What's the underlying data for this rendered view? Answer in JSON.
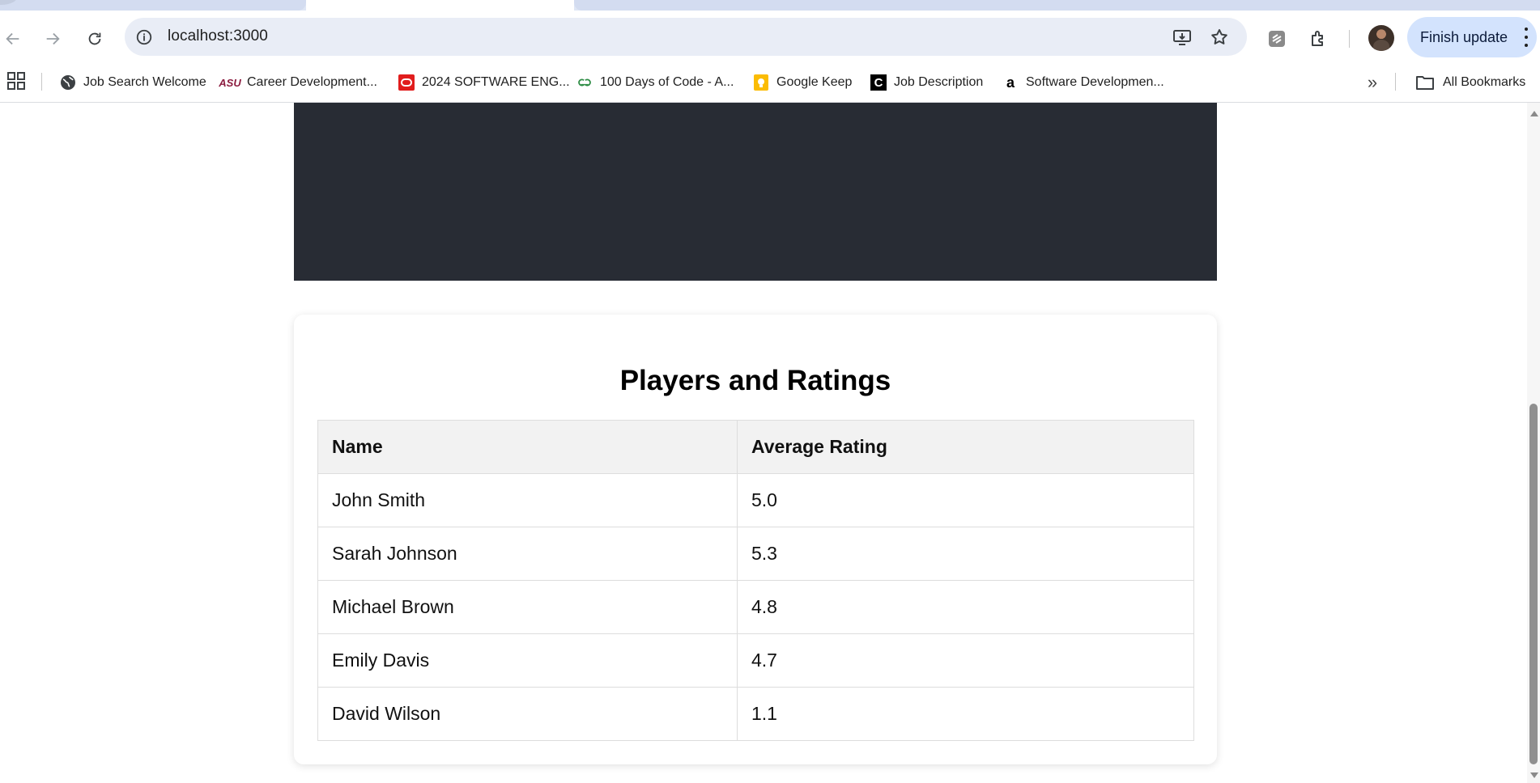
{
  "browser": {
    "url": "localhost:3000",
    "update_label": "Finish update",
    "bookmarks": [
      {
        "label": "Job Search Welcome",
        "icon": "globe-icon"
      },
      {
        "label": "Career Development...",
        "icon": "asu-logo-icon"
      },
      {
        "label": "2024 SOFTWARE ENG...",
        "icon": "oracle-logo-icon"
      },
      {
        "label": "100 Days of Code - A...",
        "icon": "geeksforgeeks-logo-icon"
      },
      {
        "label": "Google Keep",
        "icon": "google-keep-icon"
      },
      {
        "label": "Job Description",
        "icon": "c-logo-icon"
      },
      {
        "label": "Software Developmen...",
        "icon": "amazon-logo-icon"
      }
    ],
    "all_bookmarks_label": "All Bookmarks",
    "bookmark_more": "»",
    "asu_mark": "ASU",
    "c_mark": "C",
    "amazon_mark": "a"
  },
  "page": {
    "title": "Players and Ratings",
    "table": {
      "headers": [
        "Name",
        "Average Rating"
      ],
      "rows": [
        [
          "John Smith",
          "5.0"
        ],
        [
          "Sarah Johnson",
          "5.3"
        ],
        [
          "Michael Brown",
          "4.8"
        ],
        [
          "Emily Davis",
          "4.7"
        ],
        [
          "David Wilson",
          "1.1"
        ]
      ]
    }
  },
  "colors": {
    "hero_bg": "#282c34",
    "update_button_bg": "#d3e3fd",
    "omnibox_bg": "#e9edf6",
    "table_header_bg": "#f2f2f2"
  }
}
